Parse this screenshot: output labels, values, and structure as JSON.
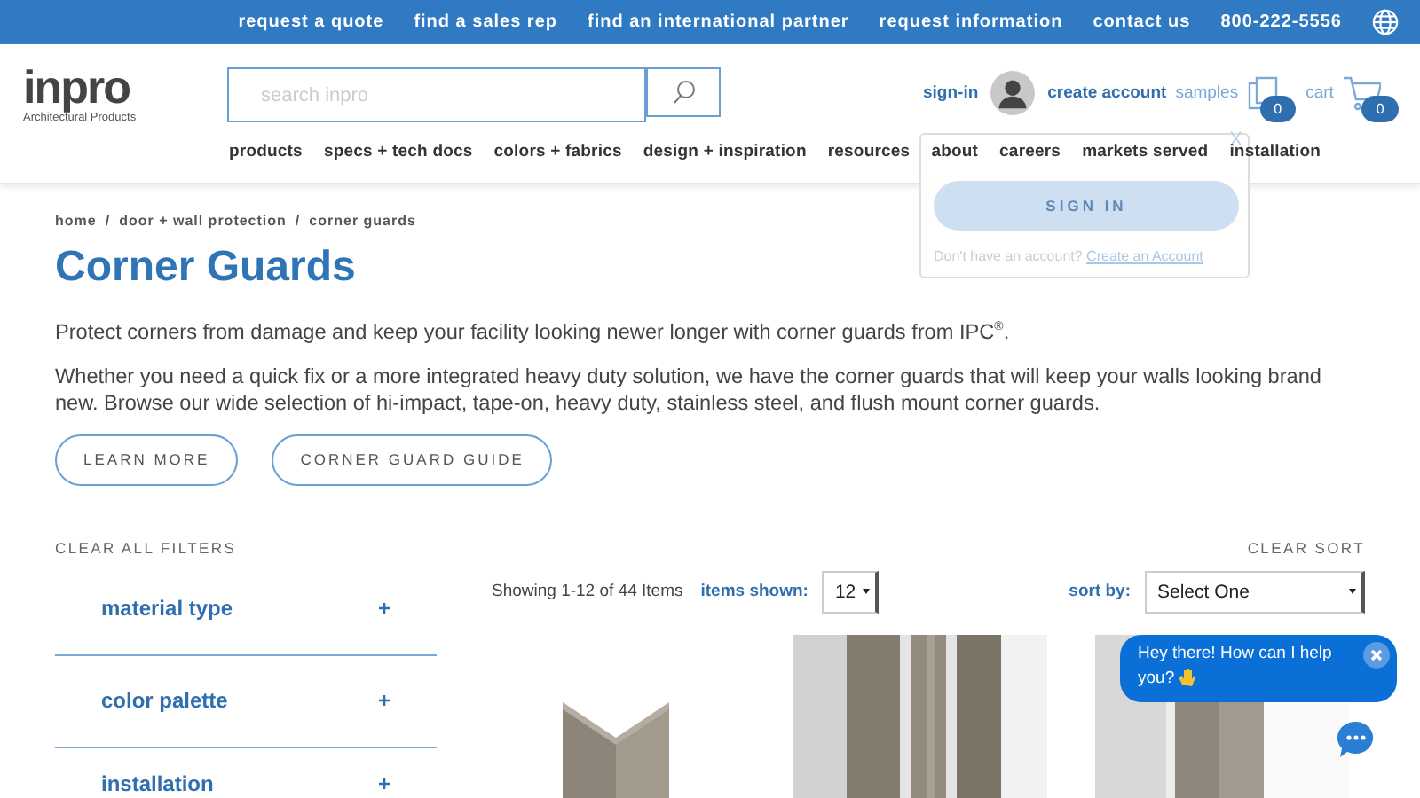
{
  "top_bar": {
    "links": [
      "request a quote",
      "find a sales rep",
      "find an international partner",
      "request information",
      "contact us",
      "800-222-5556"
    ]
  },
  "logo": {
    "name": "inpro",
    "tagline": "Architectural Products"
  },
  "search": {
    "placeholder": "search inpro"
  },
  "account": {
    "sign_in": "sign-in",
    "create_account": "create account",
    "samples": "samples",
    "samples_count": "0",
    "cart": "cart",
    "cart_count": "0"
  },
  "nav": [
    "products",
    "specs + tech docs",
    "colors + fabrics",
    "design + inspiration",
    "resources",
    "about",
    "careers",
    "markets served",
    "installation"
  ],
  "sign_in_popup": {
    "close": "X",
    "button": "SIGN IN",
    "prompt": "Don't have an account?",
    "link": "Create an Account"
  },
  "breadcrumb": [
    {
      "label": "home"
    },
    {
      "separator": "/",
      "label": "door + wall protection"
    },
    {
      "separator": "/",
      "label": "corner guards"
    }
  ],
  "title": "Corner Guards",
  "paragraphs": [
    "Protect corners from damage and keep your facility looking newer longer with corner guards from IPC$^{®}$.",
    "Whether you need a quick fix or a more integrated heavy duty solution, we have the corner guards that will keep your walls looking brand new. Browse our wide selection of hi-impact, tape-on, heavy duty, stainless steel, and flush mount corner guards."
  ],
  "buttons": [
    "LEARN MORE",
    "CORNER GUARD GUIDE"
  ],
  "filters": {
    "clear": "CLEAR ALL FILTERS",
    "items": [
      {
        "label": "material type",
        "toggle": "+"
      },
      {
        "label": "color palette",
        "toggle": "+"
      },
      {
        "label": "installation",
        "toggle": "+"
      }
    ]
  },
  "results": {
    "clear_sort": "CLEAR SORT",
    "showing": "Showing 1-12 of 44 Items",
    "items_shown_label": "items shown:",
    "items_shown": "12",
    "sort_label": "sort by:",
    "sort": "Select One"
  },
  "products": [
    {
      "kind": "picture"
    },
    {
      "kind": "picture"
    },
    {
      "kind": "picture"
    }
  ],
  "chat": {
    "message": "Hey there! How can I help you?"
  }
}
